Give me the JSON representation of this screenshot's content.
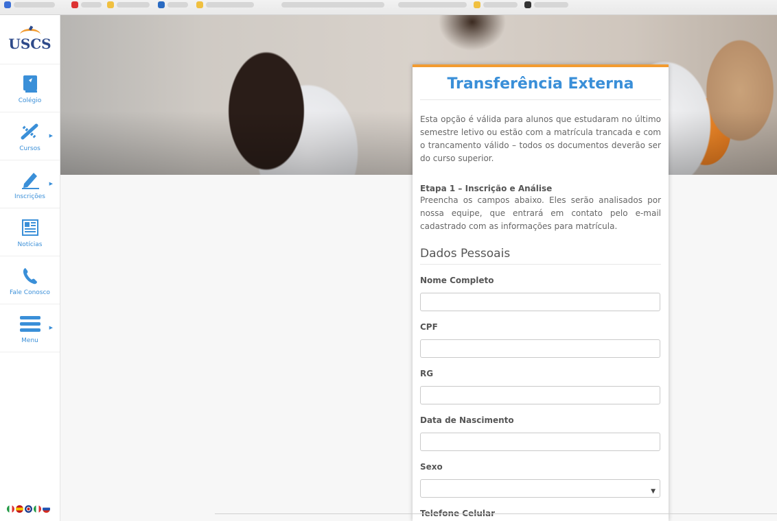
{
  "brand": {
    "logo_text": "USCS"
  },
  "sidebar": {
    "items": [
      {
        "label": "Colégio",
        "icon": "book-icon",
        "has_submenu": false
      },
      {
        "label": "Cursos",
        "icon": "tools-icon",
        "has_submenu": true
      },
      {
        "label": "Inscrições",
        "icon": "pen-icon",
        "has_submenu": true
      },
      {
        "label": "Notícias",
        "icon": "newspaper-icon",
        "has_submenu": false
      },
      {
        "label": "Fale Conosco",
        "icon": "phone-icon",
        "has_submenu": false
      },
      {
        "label": "Menu",
        "icon": "hamburger-icon",
        "has_submenu": true
      }
    ],
    "languages": [
      "italian-flag-icon",
      "spanish-flag-icon",
      "uk-flag-icon",
      "italian-flag-icon",
      "russian-flag-icon"
    ]
  },
  "form": {
    "title": "Transferência Externa",
    "intro": "Esta opção é válida para alunos que estudaram no último semestre letivo ou estão com a matrícula trancada e com o trancamento válido – todos os documentos deverão ser do curso superior.",
    "step_title": "Etapa 1 – Inscrição e Análise",
    "step_text": "Preencha os campos abaixo. Eles serão analisados por nossa equipe, que entrará em contato pelo e-mail cadastrado com as informações para matrícula.",
    "section_title": "Dados Pessoais",
    "fields": {
      "nome": {
        "label": "Nome Completo",
        "value": ""
      },
      "cpf": {
        "label": "CPF",
        "value": ""
      },
      "rg": {
        "label": "RG",
        "value": ""
      },
      "nascimento": {
        "label": "Data de Nascimento",
        "value": ""
      },
      "sexo": {
        "label": "Sexo",
        "value": ""
      },
      "celular": {
        "label": "Telefone Celular",
        "value": ""
      }
    }
  },
  "colors": {
    "accent_blue": "#3a8fd8",
    "accent_orange": "#f29b30",
    "brand_navy": "#2e4a8a"
  }
}
